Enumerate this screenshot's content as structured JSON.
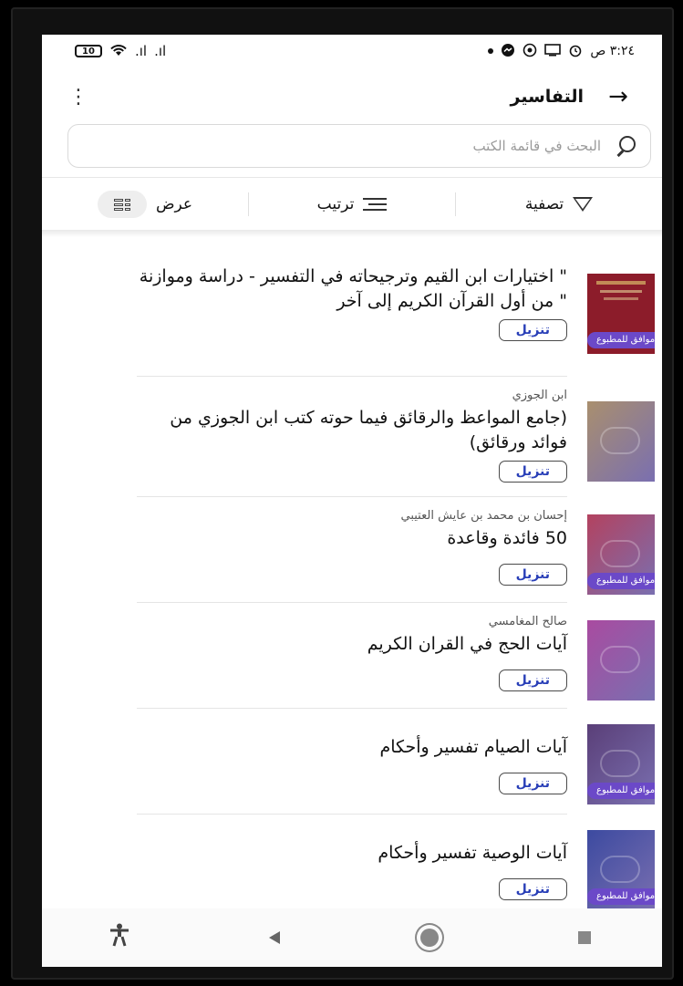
{
  "status_bar": {
    "time": "٣:٢٤ ص",
    "battery": "10",
    "signal_1": ".ıl",
    "signal_2": ".ıl"
  },
  "app_bar": {
    "title": "التفاسير",
    "back_icon": "arrow-right-icon",
    "more_icon": "more-vertical-icon"
  },
  "search": {
    "placeholder": "البحث في قائمة الكتب"
  },
  "toolbar": {
    "filter_label": "تصفية",
    "sort_label": "ترتيب",
    "view_label": "عرض"
  },
  "colors": {
    "badge": "#6b49c8",
    "download_text": "#2a40b8"
  },
  "books": [
    {
      "author": "",
      "title": "\" اختيارات ابن القيم وترجيحاته في التفسير - دراسة وموازنة \" من أول القرآن الكريم إلى آخر",
      "download": "تنزيل",
      "badge": "موافق للمطبوع",
      "cover": "#8c1c2a"
    },
    {
      "author": "ابن الجوزي",
      "title": "(جامع المواعظ والرقائق فيما حوته كتب ابن الجوزي من فوائد ورقائق)",
      "download": "تنزيل",
      "badge": "",
      "cover": "#a98f6e"
    },
    {
      "author": "إحسان بن محمد بن عايش العتيبي",
      "title": "50 فائدة وقاعدة",
      "download": "تنزيل",
      "badge": "موافق للمطبوع",
      "cover": "#b3425f"
    },
    {
      "author": "صالح المغامسي",
      "title": "آيات الحج في القران الكريم",
      "download": "تنزيل",
      "badge": "",
      "cover": "#a94ba0"
    },
    {
      "author": "",
      "title": "آيات الصيام تفسير وأحكام",
      "download": "تنزيل",
      "badge": "موافق للمطبوع",
      "cover": "#5a3f78"
    },
    {
      "author": "",
      "title": "آيات الوصية تفسير وأحكام",
      "download": "تنزيل",
      "badge": "موافق للمطبوع",
      "cover": "#3c4aa0"
    }
  ]
}
